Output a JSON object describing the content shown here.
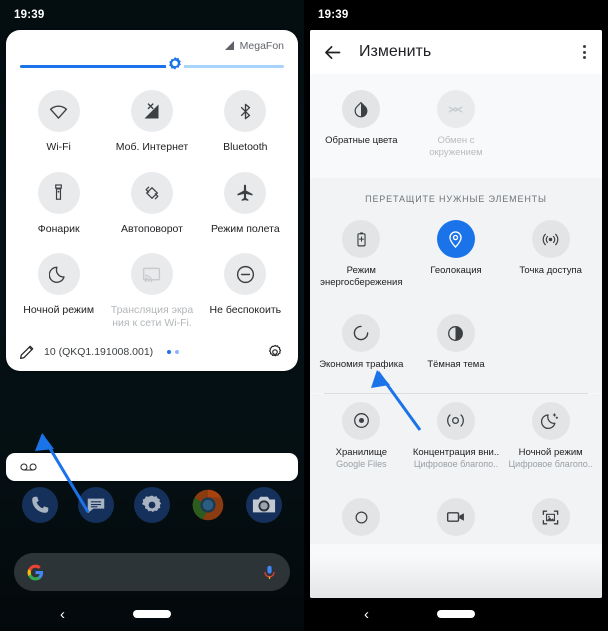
{
  "left_phone": {
    "status_bar": {
      "time": "19:39"
    },
    "quick_settings": {
      "carrier": "MegaFon",
      "brightness_percent": 58,
      "tiles": [
        {
          "label": "Wi-Fi",
          "icon": "wifi-icon",
          "state": "off"
        },
        {
          "label": "Моб. Интернет",
          "icon": "mobile-data-off-icon",
          "state": "off"
        },
        {
          "label": "Bluetooth",
          "icon": "bluetooth-icon",
          "state": "off"
        },
        {
          "label": "Фонарик",
          "icon": "flashlight-icon",
          "state": "off"
        },
        {
          "label": "Автоповорот",
          "icon": "auto-rotate-icon",
          "state": "off"
        },
        {
          "label": "Режим полета",
          "icon": "airplane-icon",
          "state": "off"
        },
        {
          "label": "Ночной режим",
          "icon": "moon-icon",
          "state": "off"
        },
        {
          "label": "Трансляция экра\nния к сети Wi-Fi.",
          "icon": "cast-screen-icon",
          "state": "disabled"
        },
        {
          "label": "Не беспокоить",
          "icon": "do-not-disturb-icon",
          "state": "off"
        }
      ],
      "footer": {
        "edit_icon": "pencil-edit-icon",
        "build_text": "10 (QKQ1.191008.001)",
        "settings_icon": "gear-icon",
        "page_dots": 2
      }
    },
    "notification": {
      "icon": "voicemail-icon"
    },
    "dock": [
      {
        "name": "phone-app",
        "icon": "phone-icon"
      },
      {
        "name": "messages-app",
        "icon": "message-icon"
      },
      {
        "name": "settings-app",
        "icon": "gear-icon"
      },
      {
        "name": "chrome-app",
        "icon": "chrome-icon"
      },
      {
        "name": "camera-app",
        "icon": "camera-icon"
      }
    ],
    "search": {
      "logo": "google-g-icon",
      "mic": "microphone-icon",
      "placeholder": ""
    },
    "nav": {
      "back": "‹",
      "home": "home-pill"
    }
  },
  "right_phone": {
    "status_bar": {
      "time": "19:39"
    },
    "app_bar": {
      "back_icon": "back-arrow-icon",
      "title": "Изменить",
      "overflow_icon": "more-vertical-icon"
    },
    "active_tiles": [
      {
        "label": "Обратные цвета",
        "icon": "invert-colors-icon",
        "state": "off"
      },
      {
        "label": "Обмен с окружением",
        "icon": "nearby-share-icon",
        "state": "disabled"
      }
    ],
    "drag_section": {
      "header": "Перетащите нужные элементы",
      "tiles": [
        {
          "label": "Режим энергосбережения",
          "icon": "battery-saver-icon",
          "state": "off",
          "sub": ""
        },
        {
          "label": "Геолокация",
          "icon": "location-pin-icon",
          "state": "on",
          "sub": ""
        },
        {
          "label": "Точка доступа",
          "icon": "hotspot-icon",
          "state": "off",
          "sub": ""
        },
        {
          "label": "Экономия трафика",
          "icon": "data-saver-icon",
          "state": "off",
          "sub": ""
        },
        {
          "label": "Тёмная тема",
          "icon": "dark-theme-icon",
          "state": "off",
          "sub": ""
        }
      ]
    },
    "bottom_section": {
      "tiles": [
        {
          "label": "Хранилище",
          "sub": "Google Files",
          "icon": "storage-icon"
        },
        {
          "label": "Концентрация вни..",
          "sub": "Цифровое благопо..",
          "icon": "focus-mode-icon"
        },
        {
          "label": "Ночной режим",
          "sub": "Цифровое благопо..",
          "icon": "night-light-icon"
        }
      ],
      "tiles_row2": [
        {
          "label": "",
          "sub": "",
          "icon": "circle-icon"
        },
        {
          "label": "",
          "sub": "",
          "icon": "screen-record-icon"
        },
        {
          "label": "",
          "sub": "",
          "icon": "screenshot-icon"
        }
      ]
    },
    "nav": {
      "back": "‹",
      "home": "home-pill"
    }
  },
  "annotations": {
    "arrow_color": "#1a73e8",
    "arrows": [
      {
        "name": "arrow-to-edit-pencil"
      },
      {
        "name": "arrow-to-data-saver-tile"
      }
    ]
  }
}
